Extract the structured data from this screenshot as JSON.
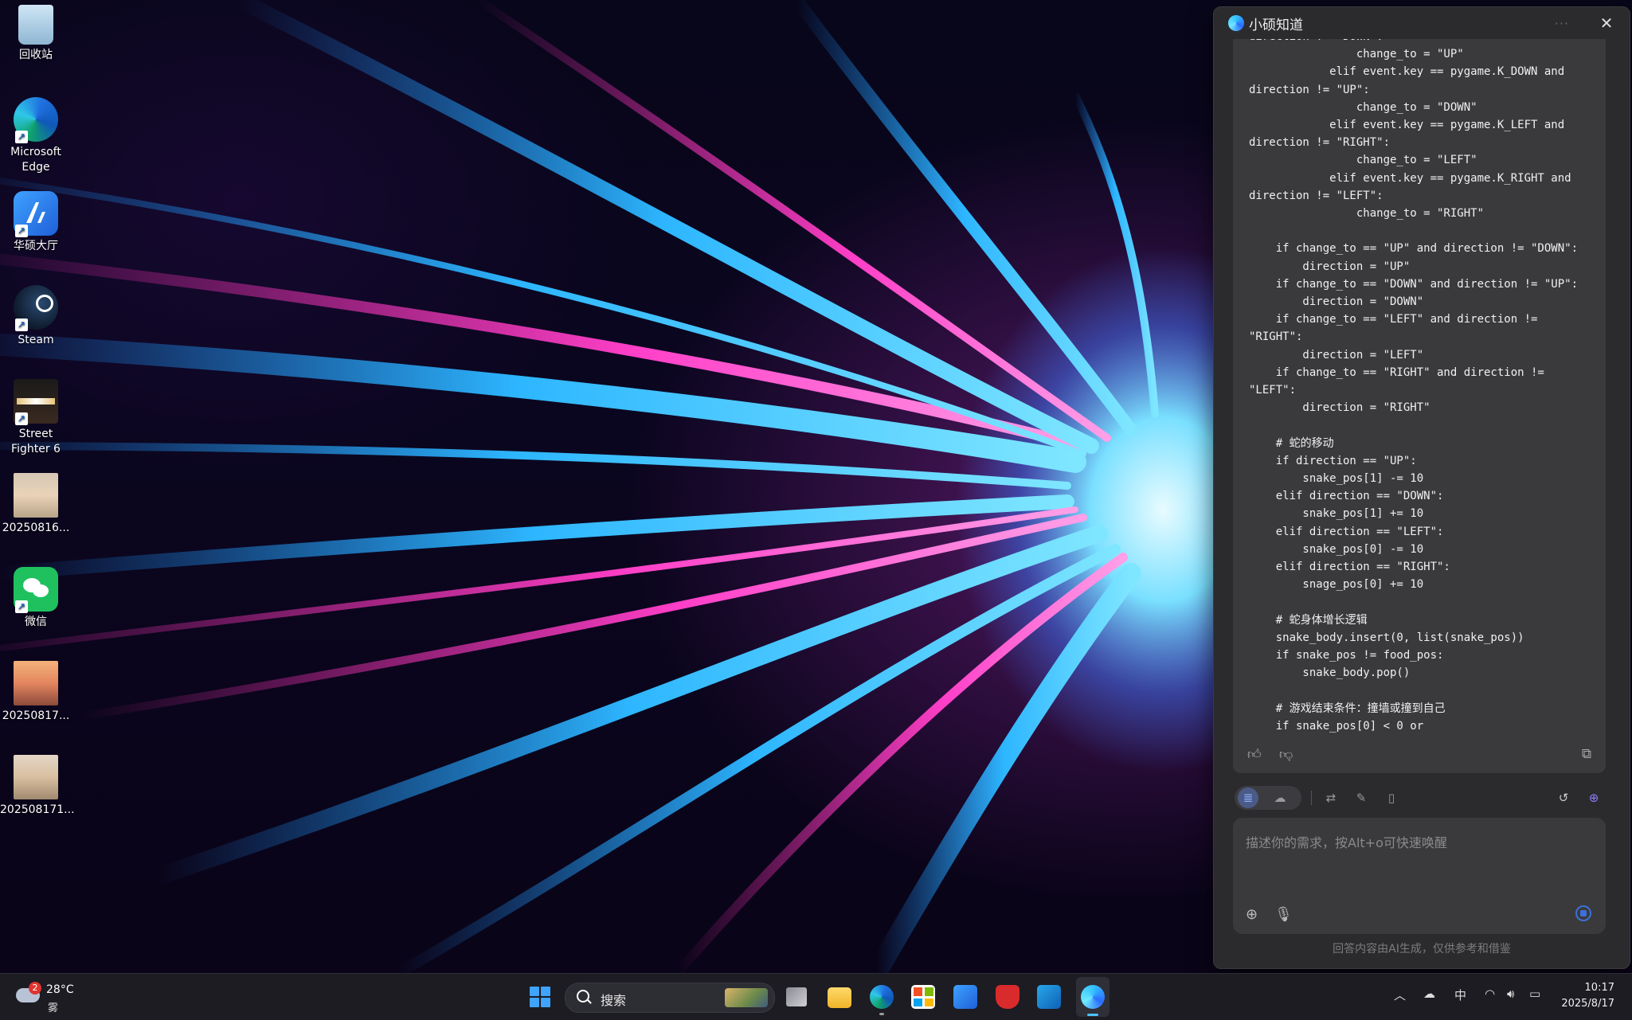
{
  "desktop": {
    "icons": [
      {
        "label": "回收站",
        "icon": "recycle-bin-icon"
      },
      {
        "label": "Microsoft Edge",
        "icon": "edge-icon"
      },
      {
        "label": "华硕大厅",
        "icon": "asus-hub-icon"
      },
      {
        "label": "Steam",
        "icon": "steam-icon"
      },
      {
        "label": "Street Fighter 6",
        "icon": "street-fighter-icon"
      },
      {
        "label": "20250816...",
        "icon": "photo-thumbnail-icon"
      },
      {
        "label": "微信",
        "icon": "wechat-icon"
      },
      {
        "label": "20250817...",
        "icon": "photo-thumbnail-icon"
      },
      {
        "label": "202508171...",
        "icon": "photo-thumbnail-icon"
      }
    ]
  },
  "assistant": {
    "title": "小硕知道",
    "more": "···",
    "close": "✕",
    "code_lines": [
      "direction != \"DOWN\":",
      "                change_to = \"UP\"",
      "            elif event.key == pygame.K_DOWN and",
      "direction != \"UP\":",
      "                change_to = \"DOWN\"",
      "            elif event.key == pygame.K_LEFT and",
      "direction != \"RIGHT\":",
      "                change_to = \"LEFT\"",
      "            elif event.key == pygame.K_RIGHT and",
      "direction != \"LEFT\":",
      "                change_to = \"RIGHT\"",
      "",
      "    if change_to == \"UP\" and direction != \"DOWN\":",
      "        direction = \"UP\"",
      "    if change_to == \"DOWN\" and direction != \"UP\":",
      "        direction = \"DOWN\"",
      "    if change_to == \"LEFT\" and direction !=",
      "\"RIGHT\":",
      "        direction = \"LEFT\"",
      "    if change_to == \"RIGHT\" and direction !=",
      "\"LEFT\":",
      "        direction = \"RIGHT\"",
      "",
      "    # 蛇的移动",
      "    if direction == \"UP\":",
      "        snake_pos[1] -= 10",
      "    elif direction == \"DOWN\":",
      "        snake_pos[1] += 10",
      "    elif direction == \"LEFT\":",
      "        snake_pos[0] -= 10",
      "    elif direction == \"RIGHT\":",
      "        snage_pos[0] += 10",
      "",
      "    # 蛇身体增长逻辑",
      "    snake_body.insert(0, list(snake_pos))",
      "    if snake_pos != food_pos:",
      "        snake_body.pop()",
      "",
      "    # 游戏结束条件：撞墙或撞到自己",
      "    if snake_pos[0] < 0 or"
    ],
    "input_placeholder": "描述你的需求，按Alt+o可快速唤醒",
    "disclaimer": "回答内容由AI生成，仅供参考和借鉴"
  },
  "taskbar": {
    "weather": {
      "temp": "28°C",
      "condition": "雾",
      "badge": "2"
    },
    "search_label": "搜索",
    "input_method": "中",
    "time": "10:17",
    "date": "2025/8/17"
  }
}
